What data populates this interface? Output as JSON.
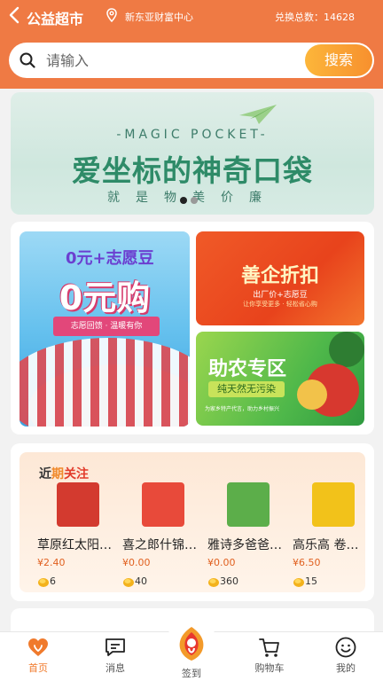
{
  "header": {
    "title": "公益超市",
    "location": "新东亚财富中心",
    "total_label": "兑换总数：",
    "total_value": "14628",
    "color": "#ef7a44"
  },
  "search": {
    "placeholder": "请输入",
    "button_label": "搜索"
  },
  "banner": {
    "subtitle": "-MAGIC POCKET-",
    "title": "爱坐标的神奇口袋",
    "slogan": "就是物美价廉",
    "page_indicator": {
      "current": 1,
      "total": 2
    }
  },
  "promos": {
    "zero": {
      "tag": "0元+志愿豆",
      "title": "0元购",
      "ribbon": "志愿回馈 · 温暖有你"
    },
    "enterprise": {
      "title": "善企折扣",
      "subtitle": "出厂价+志愿豆",
      "note": "让你享受更多 · 轻松省心购"
    },
    "farm": {
      "title": "助农专区",
      "subtitle": "纯天然无污染",
      "note": "为家乡特产代言，助力乡村振兴"
    }
  },
  "recent": {
    "title_parts": [
      "近",
      "期",
      "关注"
    ],
    "items": [
      {
        "name": "草原红太阳…",
        "price": "¥2.40",
        "points": "6",
        "thumb_color": "#d33a2f"
      },
      {
        "name": "喜之郎什锦…",
        "price": "¥0.00",
        "points": "40",
        "thumb_color": "#e84a3a"
      },
      {
        "name": "雅诗多爸爸…",
        "price": "¥0.00",
        "points": "360",
        "thumb_color": "#5cae4a"
      },
      {
        "name": "高乐高 卷…",
        "price": "¥6.50",
        "points": "15",
        "thumb_color": "#f2c21a"
      }
    ]
  },
  "tabs": [
    {
      "label": "首页",
      "icon": "home-icon",
      "active": true
    },
    {
      "label": "消息",
      "icon": "message-icon",
      "active": false
    },
    {
      "label": "签到",
      "icon": "signin-icon",
      "active": false
    },
    {
      "label": "购物车",
      "icon": "cart-icon",
      "active": false
    },
    {
      "label": "我的",
      "icon": "profile-icon",
      "active": false
    }
  ]
}
